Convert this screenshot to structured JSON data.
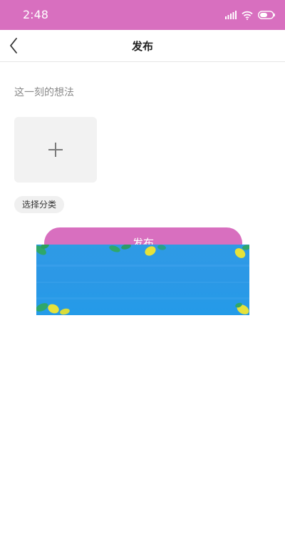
{
  "status_bar": {
    "time": "2:48",
    "icons": [
      "signal-icon",
      "wifi-icon",
      "battery-icon"
    ]
  },
  "navbar": {
    "back_icon": "chevron-left-icon",
    "title": "发布"
  },
  "form": {
    "thoughts_placeholder": "这一刻的想法",
    "thoughts_value": "",
    "add_image_icon": "plus-icon",
    "category_label": "选择分类"
  },
  "publish_button": {
    "label": "发布"
  },
  "ad_banner": {
    "icon": "leaf-icon"
  },
  "colors": {
    "accent": "#d86fbf",
    "banner_blue": "#2c98e6",
    "leaf_yellow": "#e6e23a",
    "leaf_green": "#2fa76a"
  }
}
